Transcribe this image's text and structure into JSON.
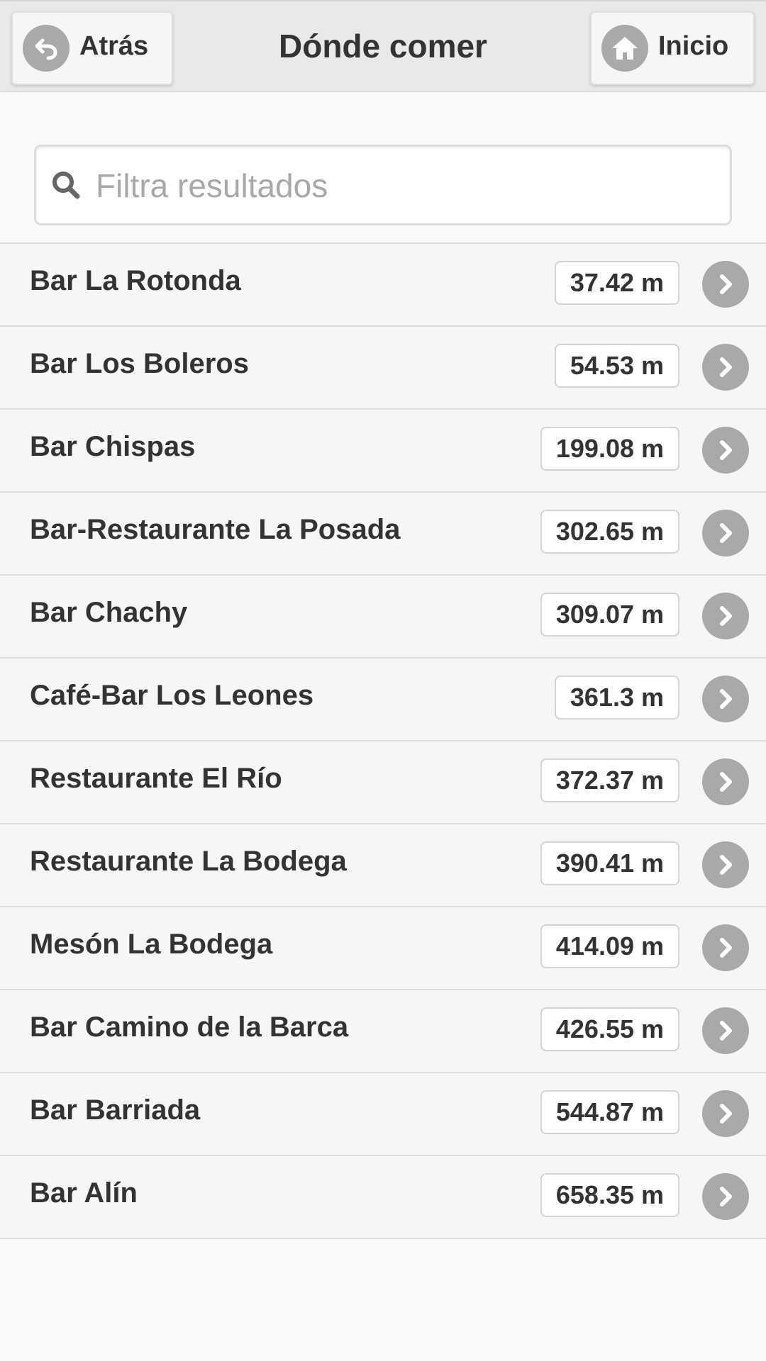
{
  "header": {
    "back_label": "Atrás",
    "title": "Dónde comer",
    "home_label": "Inicio"
  },
  "search": {
    "placeholder": "Filtra resultados",
    "value": ""
  },
  "colors": {
    "header_bg": "#e9e9e9",
    "icon_gray": "#a9a9a9",
    "text": "#333333",
    "row_bg": "#f6f6f6"
  },
  "icons": {
    "back": "back-arrow-icon",
    "home": "home-icon",
    "search": "search-icon",
    "row_arrow": "chevron-right-icon"
  },
  "places": [
    {
      "name": "Bar La Rotonda",
      "distance": "37.42 m"
    },
    {
      "name": "Bar Los Boleros",
      "distance": "54.53 m"
    },
    {
      "name": "Bar Chispas",
      "distance": "199.08 m"
    },
    {
      "name": "Bar-Restaurante La Posada",
      "distance": "302.65 m"
    },
    {
      "name": "Bar Chachy",
      "distance": "309.07 m"
    },
    {
      "name": "Café-Bar Los Leones",
      "distance": "361.3 m"
    },
    {
      "name": "Restaurante El Río",
      "distance": "372.37 m"
    },
    {
      "name": "Restaurante La Bodega",
      "distance": "390.41 m"
    },
    {
      "name": "Mesón La Bodega",
      "distance": "414.09 m"
    },
    {
      "name": "Bar Camino de la Barca",
      "distance": "426.55 m"
    },
    {
      "name": "Bar Barriada",
      "distance": "544.87 m"
    },
    {
      "name": "Bar Alín",
      "distance": "658.35 m"
    }
  ]
}
